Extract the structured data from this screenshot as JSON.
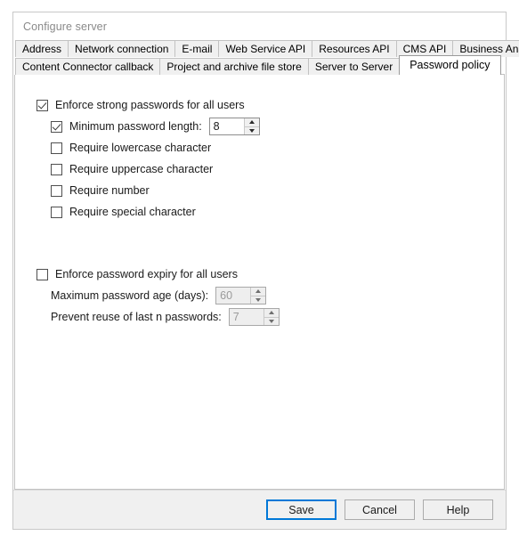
{
  "window": {
    "title": "Configure server"
  },
  "tabs": {
    "row1": [
      {
        "label": "Address",
        "active": false
      },
      {
        "label": "Network connection",
        "active": false
      },
      {
        "label": "E-mail",
        "active": false
      },
      {
        "label": "Web Service API",
        "active": false
      },
      {
        "label": "Resources API",
        "active": false
      },
      {
        "label": "CMS API",
        "active": false
      },
      {
        "label": "Business Analytics API",
        "active": false
      }
    ],
    "row2": [
      {
        "label": "Content Connector callback",
        "active": false
      },
      {
        "label": "Project and archive file store",
        "active": false
      },
      {
        "label": "Server to Server",
        "active": false
      },
      {
        "label": "Password policy",
        "active": true
      }
    ]
  },
  "form": {
    "strong_passwords": {
      "label": "Enforce strong passwords for all users",
      "checked": true
    },
    "min_length": {
      "label": "Minimum password length:",
      "checked": true,
      "value": "8"
    },
    "require_lowercase": {
      "label": "Require lowercase character",
      "checked": false
    },
    "require_uppercase": {
      "label": "Require uppercase character",
      "checked": false
    },
    "require_number": {
      "label": "Require number",
      "checked": false
    },
    "require_special": {
      "label": "Require special character",
      "checked": false
    },
    "password_expiry": {
      "label": "Enforce password expiry for all users",
      "checked": false
    },
    "max_age": {
      "label": "Maximum password age (days):",
      "value": "60",
      "disabled": true
    },
    "prevent_reuse": {
      "label": "Prevent reuse of last n passwords:",
      "value": "7",
      "disabled": true
    }
  },
  "buttons": {
    "save": "Save",
    "cancel": "Cancel",
    "help": "Help"
  },
  "colors": {
    "accent": "#0078d7",
    "panel": "#ffffff",
    "chrome": "#f0f0f0"
  }
}
